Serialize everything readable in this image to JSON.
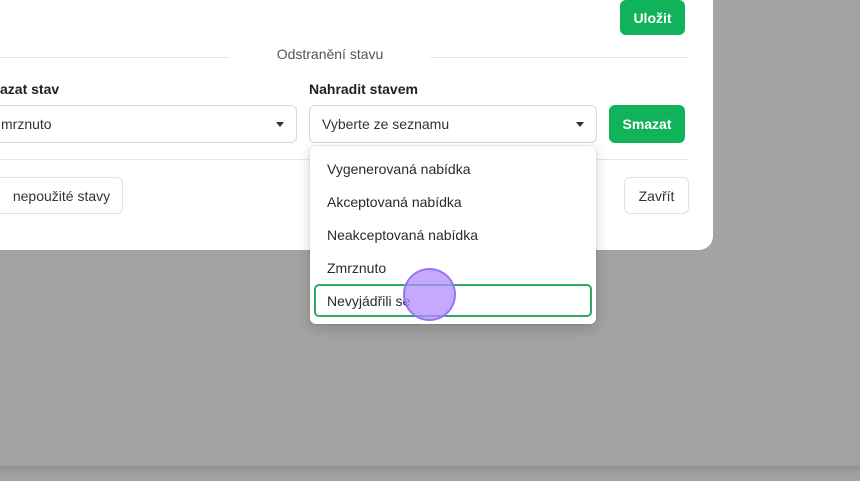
{
  "toolbar": {
    "save_label": "Uložit"
  },
  "section": {
    "title": "Odstranění stavu"
  },
  "delete_state": {
    "label": "azat stav",
    "value": "mrznuto"
  },
  "replace_state": {
    "label": "Nahradit stavem",
    "placeholder": "Vyberte ze seznamu"
  },
  "actions": {
    "delete_label": "Smazat",
    "unused_label": "nepoužité stavy",
    "close_label": "Zavřít"
  },
  "dropdown": {
    "options": [
      {
        "label": "Vygenerovaná nabídka"
      },
      {
        "label": "Akceptovaná nabídka"
      },
      {
        "label": "Neakceptovaná nabídka"
      },
      {
        "label": "Zmrznuto"
      },
      {
        "label": "Nevyjádřili se"
      }
    ]
  },
  "colors": {
    "accent_green": "#10b35a",
    "focus_border": "#2fa866",
    "overlay": "#a3a3a3",
    "cursor": "#b08cff"
  }
}
